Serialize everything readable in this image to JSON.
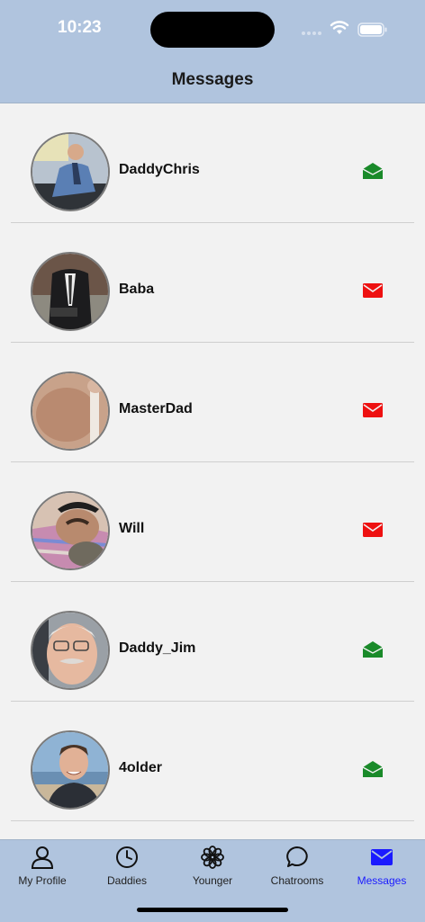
{
  "status_bar": {
    "time": "10:23"
  },
  "header": {
    "title": "Messages"
  },
  "conversations": [
    {
      "name": "DaddyChris",
      "mail_state": "read",
      "mail_color": "#1a8a2a"
    },
    {
      "name": "Baba",
      "mail_state": "unread",
      "mail_color": "#ee1111"
    },
    {
      "name": "MasterDad",
      "mail_state": "unread",
      "mail_color": "#ee1111"
    },
    {
      "name": "Will",
      "mail_state": "unread",
      "mail_color": "#ee1111"
    },
    {
      "name": "Daddy_Jim",
      "mail_state": "read",
      "mail_color": "#1a8a2a"
    },
    {
      "name": "4older",
      "mail_state": "read",
      "mail_color": "#1a8a2a"
    }
  ],
  "tabs": [
    {
      "label": "My Profile",
      "icon": "person-icon"
    },
    {
      "label": "Daddies",
      "icon": "clock-icon"
    },
    {
      "label": "Younger",
      "icon": "flower-icon"
    },
    {
      "label": "Chatrooms",
      "icon": "chat-bubble-icon"
    },
    {
      "label": "Messages",
      "icon": "envelope-icon",
      "active": true
    }
  ],
  "colors": {
    "bar_background": "#b0c4de",
    "active_tab": "#1a1aff",
    "unread": "#ee1111",
    "read": "#1a8a2a"
  }
}
